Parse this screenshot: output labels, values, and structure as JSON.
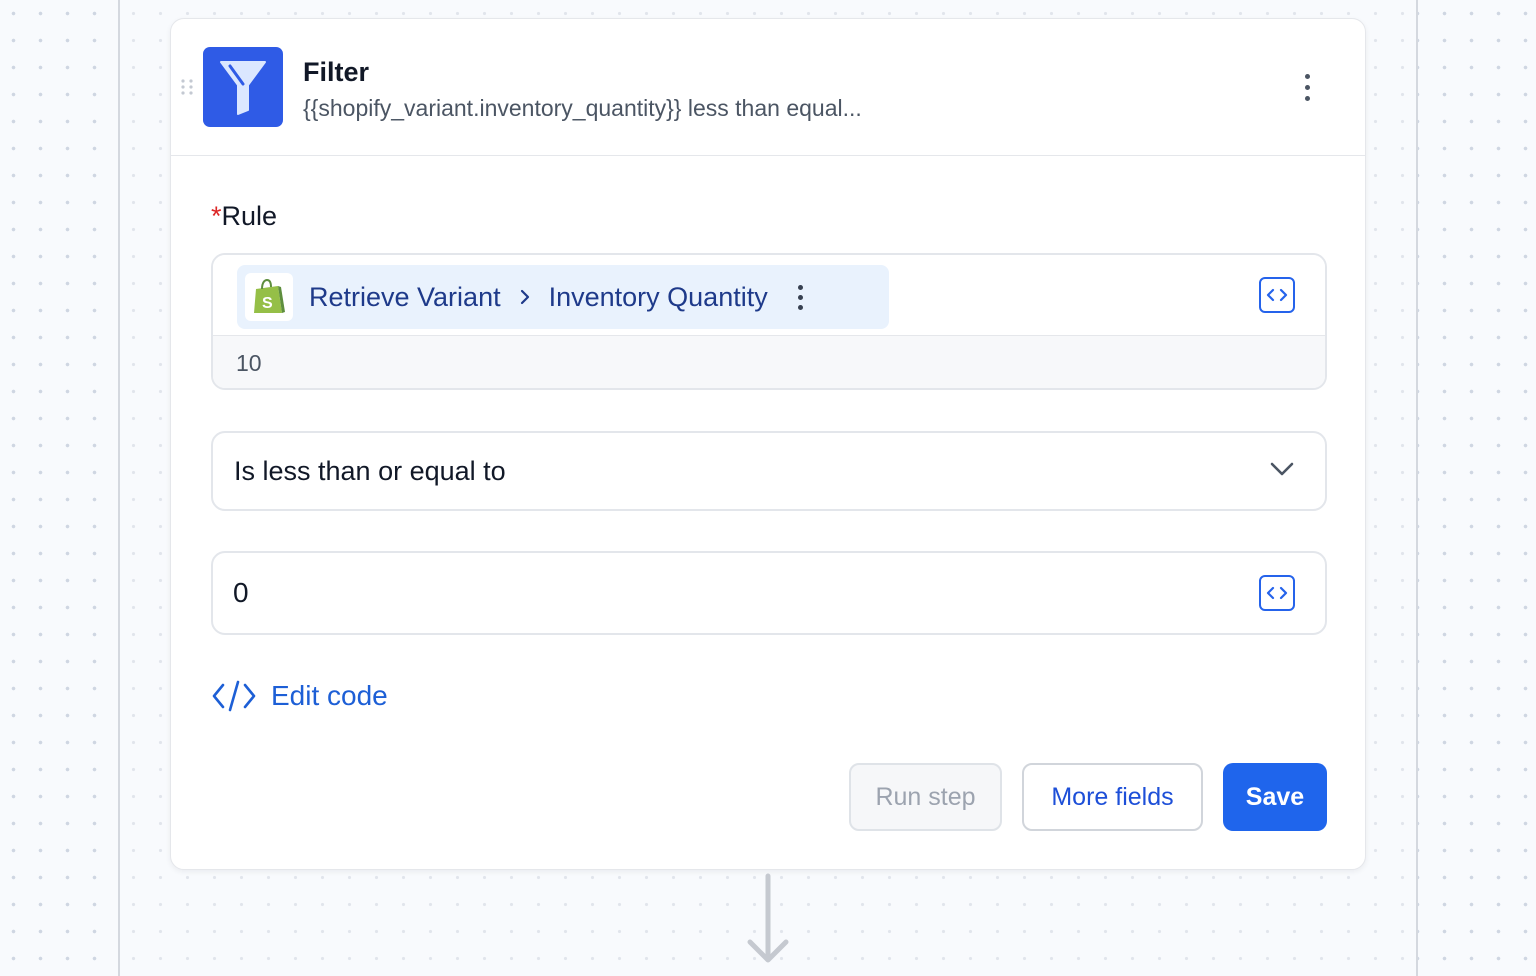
{
  "step": {
    "title": "Filter",
    "subtitle": "{{shopify_variant.inventory_quantity}} less than equal...",
    "icon": "funnel-icon",
    "icon_bg": "#2f5be6"
  },
  "rule": {
    "required_mark": "*",
    "label": "Rule",
    "variable": {
      "app_icon": "shopify-logo-icon",
      "source": "Retrieve Variant",
      "field": "Inventory Quantity"
    },
    "preview_value": "10"
  },
  "operator": {
    "selected": "Is less than or equal to"
  },
  "compare_value": "0",
  "edit_code_label": "Edit code",
  "buttons": {
    "run_step": "Run step",
    "more_fields": "More fields",
    "save": "Save"
  },
  "colors": {
    "accent": "#1f65ec",
    "required": "#dc2626",
    "pill_bg": "#e9f2fd"
  }
}
